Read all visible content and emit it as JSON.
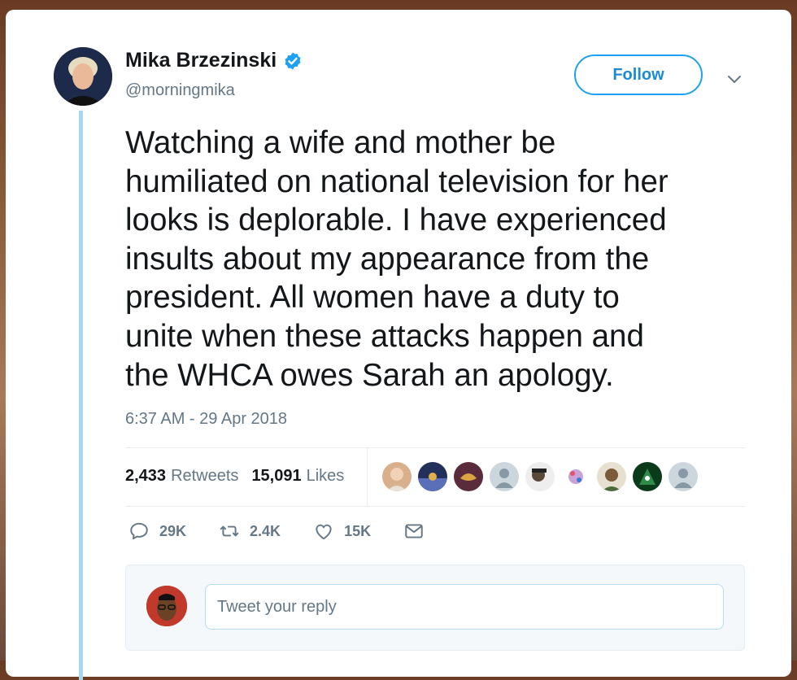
{
  "author": {
    "name": "Mika Brzezinski",
    "handle": "@morningmika",
    "verified": true
  },
  "follow_label": "Follow",
  "tweet": {
    "text": "Watching a wife and mother be\nhumiliated on national television for her\nlooks is deplorable. I have experienced\ninsults about my appearance from the\npresident. All women have a duty to\nunite when these attacks happen and\nthe WHCA owes Sarah an apology.",
    "timestamp": "6:37 AM - 29 Apr 2018"
  },
  "stats": {
    "retweets_count": "2,433",
    "retweets_label": "Retweets",
    "likes_count": "15,091",
    "likes_label": "Likes"
  },
  "actions": {
    "replies": "29K",
    "retweets": "2.4K",
    "likes": "15K"
  },
  "reply": {
    "placeholder": "Tweet your reply"
  },
  "colors": {
    "accent": "#1da1f2",
    "thread_line": "#a5d8ee",
    "muted": "#657786",
    "text": "#14171a"
  },
  "icons": [
    "verified-badge-icon",
    "chevron-down-icon",
    "reply-icon",
    "retweet-icon",
    "like-icon",
    "direct-message-icon"
  ]
}
